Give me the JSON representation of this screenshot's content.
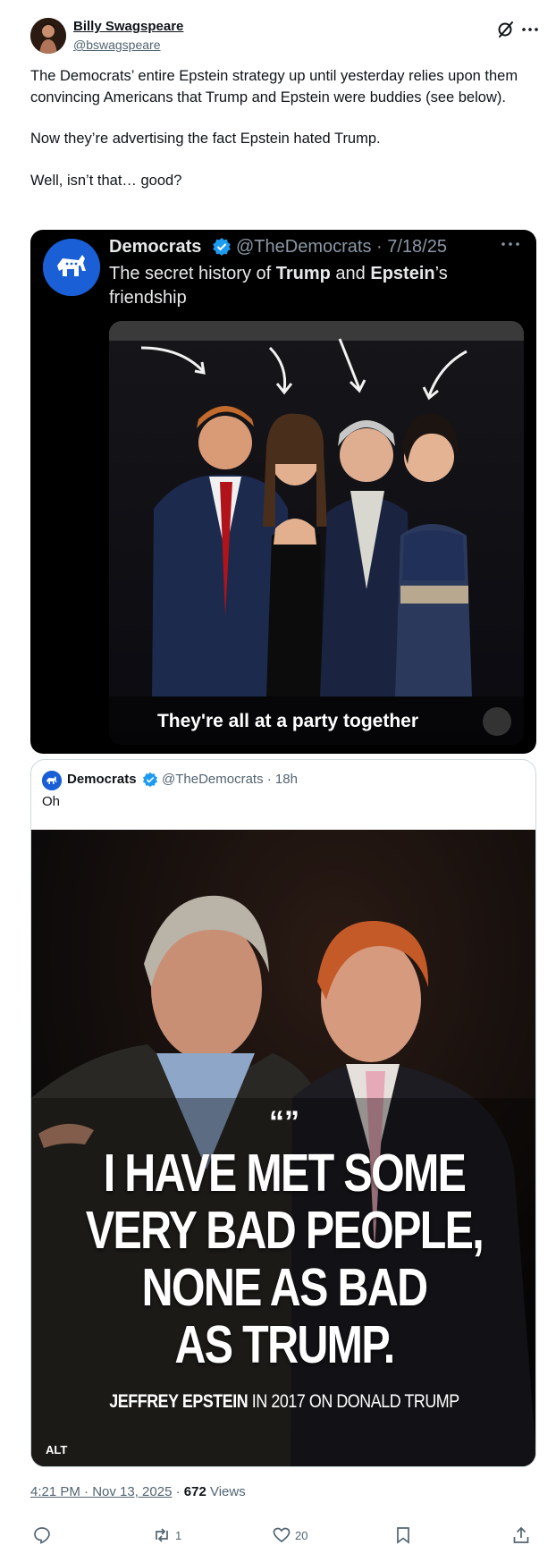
{
  "author": {
    "name": "Billy Swagspeare",
    "handle": "@bswagspeare"
  },
  "tweet": {
    "paragraphs": [
      "The Democrats’ entire Epstein strategy up until yesterday relies upon them convincing Americans that Trump and Epstein were buddies (see below).",
      "Now they’re advertising the fact Epstein hated Trump.",
      "Well, isn’t that… good?"
    ]
  },
  "screenshot_card": {
    "name": "Democrats",
    "handle_date": "@TheDemocrats · 7/18/25",
    "text_parts": [
      "The secret history of ",
      "Trump",
      " and ",
      "Epstein",
      "’s friendship"
    ],
    "video_caption": "They're all at a party together"
  },
  "quote_card": {
    "name": "Democrats",
    "handle_time": "@TheDemocrats · 18h",
    "text": "Oh",
    "image_quote_mark": "“”",
    "image_headline_lines": [
      "I HAVE MET SOME",
      "VERY BAD PEOPLE,",
      "NONE AS BAD",
      "AS TRUMP."
    ],
    "image_attribution_bold": "JEFFREY EPSTEIN",
    "image_attribution_rest": " IN 2017 ON DONALD TRUMP",
    "alt_badge": "ALT"
  },
  "meta": {
    "time": "4:21 PM · Nov 13, 2025",
    "separator": " · ",
    "views_count": "672",
    "views_label": " Views"
  },
  "actions": {
    "reply_count": "",
    "repost_count": "1",
    "like_count": "20"
  },
  "colors": {
    "brand_blue": "#1d9bf0",
    "dem_blue": "#1a5fd6",
    "text_primary": "#0f1419",
    "text_secondary": "#536471"
  }
}
